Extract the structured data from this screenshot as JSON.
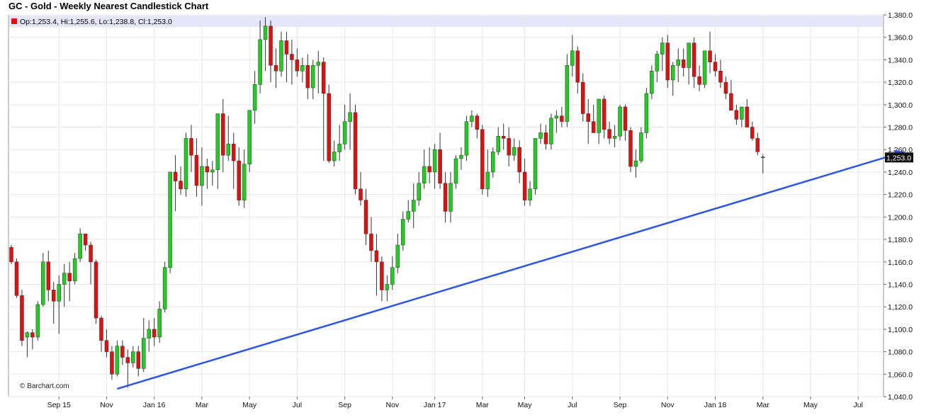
{
  "title": "GC - Gold - Weekly Nearest Candlestick Chart",
  "ohlc_readout": "Op:1,253.4, Hi:1,255.6, Lo:1,238.8, Cl:1,253.0",
  "last_price_label": "1,253.0",
  "credit": "© Barchart.com",
  "colors": {
    "up": "#22cc22",
    "down": "#dd1111",
    "trendline": "#2b55e6",
    "header_band": "#e6e6fa",
    "grid": "#e8e8e8"
  },
  "chart_data": {
    "type": "candlestick",
    "title": "GC - Gold - Weekly Nearest Candlestick Chart",
    "ylim": [
      1040,
      1380
    ],
    "y_ticks": [
      1040,
      1060,
      1080,
      1100,
      1120,
      1140,
      1160,
      1180,
      1200,
      1220,
      1240,
      1260,
      1280,
      1300,
      1320,
      1340,
      1360,
      1380
    ],
    "y_tick_labels": [
      "1,040.0",
      "1,060.0",
      "1,080.0",
      "1,100.0",
      "1,120.0",
      "1,140.0",
      "1,160.0",
      "1,180.0",
      "1,200.0",
      "1,220.0",
      "1,240.0",
      "1,260.0",
      "1,280.0",
      "1,300.0",
      "1,320.0",
      "1,340.0",
      "1,360.0",
      "1,380.0"
    ],
    "x_ticks": [
      {
        "label": "Sep 15",
        "index": 9
      },
      {
        "label": "Nov",
        "index": 18
      },
      {
        "label": "Jan 16",
        "index": 27
      },
      {
        "label": "Mar",
        "index": 36
      },
      {
        "label": "May",
        "index": 45
      },
      {
        "label": "Jul",
        "index": 54
      },
      {
        "label": "Sep",
        "index": 63
      },
      {
        "label": "Nov",
        "index": 72
      },
      {
        "label": "Jan 17",
        "index": 80
      },
      {
        "label": "Mar",
        "index": 89
      },
      {
        "label": "May",
        "index": 97
      },
      {
        "label": "Jul",
        "index": 106
      },
      {
        "label": "Sep",
        "index": 115
      },
      {
        "label": "Nov",
        "index": 124
      },
      {
        "label": "Jan 18",
        "index": 133
      },
      {
        "label": "Mar",
        "index": 142
      },
      {
        "label": "May",
        "index": 151
      },
      {
        "label": "Jul",
        "index": 160
      }
    ],
    "candles": [
      [
        1173,
        1175,
        1158,
        1160
      ],
      [
        1160,
        1163,
        1128,
        1130
      ],
      [
        1130,
        1135,
        1085,
        1090
      ],
      [
        1093,
        1098,
        1075,
        1097
      ],
      [
        1097,
        1100,
        1082,
        1093
      ],
      [
        1093,
        1125,
        1090,
        1122
      ],
      [
        1122,
        1168,
        1120,
        1160
      ],
      [
        1160,
        1170,
        1125,
        1135
      ],
      [
        1135,
        1142,
        1105,
        1125
      ],
      [
        1125,
        1148,
        1096,
        1140
      ],
      [
        1140,
        1158,
        1120,
        1150
      ],
      [
        1150,
        1160,
        1125,
        1143
      ],
      [
        1143,
        1168,
        1140,
        1163
      ],
      [
        1163,
        1190,
        1160,
        1185
      ],
      [
        1185,
        1185,
        1170,
        1175
      ],
      [
        1175,
        1178,
        1140,
        1160
      ],
      [
        1160,
        1162,
        1105,
        1110
      ],
      [
        1110,
        1112,
        1080,
        1090
      ],
      [
        1090,
        1100,
        1075,
        1080
      ],
      [
        1080,
        1085,
        1055,
        1060
      ],
      [
        1060,
        1090,
        1058,
        1085
      ],
      [
        1085,
        1090,
        1068,
        1075
      ],
      [
        1075,
        1082,
        1048,
        1070
      ],
      [
        1070,
        1085,
        1066,
        1080
      ],
      [
        1080,
        1085,
        1058,
        1065
      ],
      [
        1065,
        1110,
        1062,
        1092
      ],
      [
        1092,
        1108,
        1080,
        1100
      ],
      [
        1100,
        1110,
        1085,
        1093
      ],
      [
        1093,
        1125,
        1088,
        1118
      ],
      [
        1118,
        1160,
        1115,
        1155
      ],
      [
        1155,
        1200,
        1150,
        1240
      ],
      [
        1240,
        1255,
        1205,
        1232
      ],
      [
        1232,
        1245,
        1220,
        1225
      ],
      [
        1225,
        1275,
        1218,
        1270
      ],
      [
        1270,
        1282,
        1240,
        1255
      ],
      [
        1255,
        1270,
        1218,
        1228
      ],
      [
        1228,
        1262,
        1210,
        1245
      ],
      [
        1245,
        1252,
        1225,
        1240
      ],
      [
        1240,
        1250,
        1228,
        1242
      ],
      [
        1242,
        1270,
        1225,
        1292
      ],
      [
        1292,
        1305,
        1240,
        1255
      ],
      [
        1255,
        1290,
        1250,
        1265
      ],
      [
        1265,
        1275,
        1225,
        1250
      ],
      [
        1250,
        1262,
        1210,
        1215
      ],
      [
        1215,
        1260,
        1208,
        1247
      ],
      [
        1247,
        1292,
        1240,
        1295
      ],
      [
        1295,
        1330,
        1283,
        1318
      ],
      [
        1318,
        1375,
        1310,
        1358
      ],
      [
        1358,
        1378,
        1330,
        1370
      ],
      [
        1370,
        1375,
        1320,
        1335
      ],
      [
        1335,
        1350,
        1315,
        1330
      ],
      [
        1330,
        1365,
        1325,
        1357
      ],
      [
        1357,
        1365,
        1320,
        1345
      ],
      [
        1345,
        1358,
        1318,
        1340
      ],
      [
        1340,
        1350,
        1325,
        1330
      ],
      [
        1330,
        1342,
        1320,
        1335
      ],
      [
        1335,
        1345,
        1305,
        1315
      ],
      [
        1315,
        1340,
        1305,
        1335
      ],
      [
        1335,
        1348,
        1310,
        1338
      ],
      [
        1338,
        1342,
        1250,
        1310
      ],
      [
        1310,
        1318,
        1248,
        1250
      ],
      [
        1250,
        1268,
        1245,
        1258
      ],
      [
        1258,
        1282,
        1250,
        1265
      ],
      [
        1265,
        1300,
        1260,
        1285
      ],
      [
        1285,
        1310,
        1260,
        1293
      ],
      [
        1293,
        1300,
        1220,
        1225
      ],
      [
        1225,
        1240,
        1210,
        1215
      ],
      [
        1215,
        1225,
        1175,
        1185
      ],
      [
        1185,
        1200,
        1160,
        1170
      ],
      [
        1170,
        1185,
        1130,
        1160
      ],
      [
        1160,
        1165,
        1125,
        1135
      ],
      [
        1135,
        1148,
        1125,
        1140
      ],
      [
        1140,
        1165,
        1135,
        1155
      ],
      [
        1155,
        1185,
        1150,
        1175
      ],
      [
        1175,
        1205,
        1170,
        1198
      ],
      [
        1198,
        1215,
        1195,
        1205
      ],
      [
        1205,
        1230,
        1190,
        1215
      ],
      [
        1215,
        1240,
        1210,
        1230
      ],
      [
        1230,
        1260,
        1225,
        1245
      ],
      [
        1245,
        1262,
        1230,
        1240
      ],
      [
        1240,
        1265,
        1225,
        1260
      ],
      [
        1260,
        1275,
        1225,
        1230
      ],
      [
        1230,
        1240,
        1195,
        1205
      ],
      [
        1205,
        1240,
        1195,
        1230
      ],
      [
        1230,
        1255,
        1225,
        1252
      ],
      [
        1252,
        1262,
        1242,
        1255
      ],
      [
        1255,
        1290,
        1250,
        1285
      ],
      [
        1285,
        1295,
        1280,
        1290
      ],
      [
        1290,
        1292,
        1270,
        1278
      ],
      [
        1278,
        1282,
        1220,
        1225
      ],
      [
        1225,
        1260,
        1218,
        1240
      ],
      [
        1240,
        1262,
        1235,
        1258
      ],
      [
        1258,
        1280,
        1255,
        1272
      ],
      [
        1272,
        1283,
        1260,
        1270
      ],
      [
        1270,
        1280,
        1245,
        1255
      ],
      [
        1255,
        1270,
        1250,
        1262
      ],
      [
        1262,
        1268,
        1230,
        1240
      ],
      [
        1240,
        1252,
        1210,
        1215
      ],
      [
        1215,
        1232,
        1210,
        1225
      ],
      [
        1225,
        1262,
        1220,
        1270
      ],
      [
        1270,
        1283,
        1265,
        1275
      ],
      [
        1275,
        1282,
        1260,
        1265
      ],
      [
        1265,
        1292,
        1260,
        1288
      ],
      [
        1288,
        1295,
        1275,
        1290
      ],
      [
        1290,
        1298,
        1280,
        1285
      ],
      [
        1285,
        1345,
        1280,
        1335
      ],
      [
        1335,
        1362,
        1325,
        1348
      ],
      [
        1348,
        1352,
        1310,
        1320
      ],
      [
        1320,
        1328,
        1285,
        1292
      ],
      [
        1292,
        1305,
        1265,
        1285
      ],
      [
        1285,
        1300,
        1278,
        1275
      ],
      [
        1275,
        1300,
        1265,
        1305
      ],
      [
        1305,
        1308,
        1270,
        1278
      ],
      [
        1278,
        1285,
        1265,
        1270
      ],
      [
        1270,
        1282,
        1262,
        1272
      ],
      [
        1272,
        1300,
        1268,
        1298
      ],
      [
        1298,
        1300,
        1268,
        1277
      ],
      [
        1277,
        1280,
        1240,
        1245
      ],
      [
        1245,
        1260,
        1235,
        1250
      ],
      [
        1250,
        1280,
        1248,
        1275
      ],
      [
        1275,
        1315,
        1270,
        1310
      ],
      [
        1310,
        1335,
        1305,
        1330
      ],
      [
        1330,
        1348,
        1320,
        1345
      ],
      [
        1345,
        1360,
        1330,
        1355
      ],
      [
        1355,
        1362,
        1315,
        1322
      ],
      [
        1322,
        1338,
        1308,
        1335
      ],
      [
        1335,
        1350,
        1320,
        1340
      ],
      [
        1340,
        1350,
        1325,
        1333
      ],
      [
        1333,
        1352,
        1318,
        1355
      ],
      [
        1355,
        1360,
        1315,
        1325
      ],
      [
        1325,
        1335,
        1312,
        1318
      ],
      [
        1318,
        1340,
        1315,
        1348
      ],
      [
        1348,
        1365,
        1328,
        1338
      ],
      [
        1338,
        1345,
        1325,
        1330
      ],
      [
        1330,
        1340,
        1315,
        1320
      ],
      [
        1320,
        1325,
        1305,
        1310
      ],
      [
        1310,
        1322,
        1295,
        1295
      ],
      [
        1295,
        1300,
        1282,
        1287
      ],
      [
        1287,
        1298,
        1280,
        1298
      ],
      [
        1298,
        1305,
        1285,
        1280
      ],
      [
        1280,
        1285,
        1268,
        1270
      ],
      [
        1270,
        1275,
        1255,
        1258
      ],
      [
        1253.4,
        1255.6,
        1238.8,
        1253.0
      ]
    ],
    "trendline": {
      "from": {
        "index": 20,
        "value": 1047
      },
      "to": {
        "index": 163,
        "value": 1250
      }
    },
    "last_price": 1253.0
  }
}
